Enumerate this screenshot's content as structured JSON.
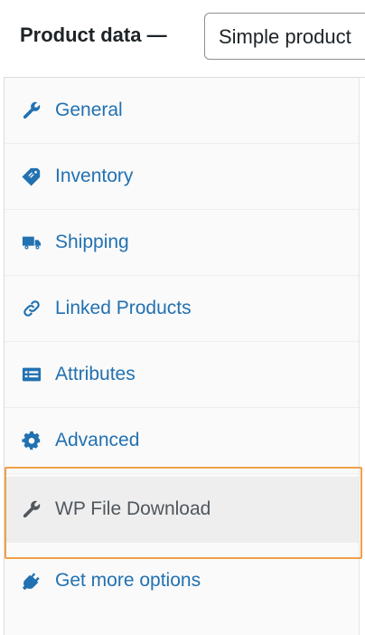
{
  "header": {
    "title": "Product data —",
    "product_type_selected": "Simple product"
  },
  "tabs": [
    {
      "label": "General",
      "icon": "wrench-icon"
    },
    {
      "label": "Inventory",
      "icon": "tag-icon"
    },
    {
      "label": "Shipping",
      "icon": "truck-icon"
    },
    {
      "label": "Linked Products",
      "icon": "link-icon"
    },
    {
      "label": "Attributes",
      "icon": "list-icon"
    },
    {
      "label": "Advanced",
      "icon": "gear-icon"
    },
    {
      "label": "WP File Download",
      "icon": "wrench-icon",
      "active": true
    },
    {
      "label": "Get more options",
      "icon": "plug-icon"
    }
  ],
  "colors": {
    "link": "#2271b1",
    "active_text": "#50575e",
    "highlight": "#f0a04b"
  }
}
